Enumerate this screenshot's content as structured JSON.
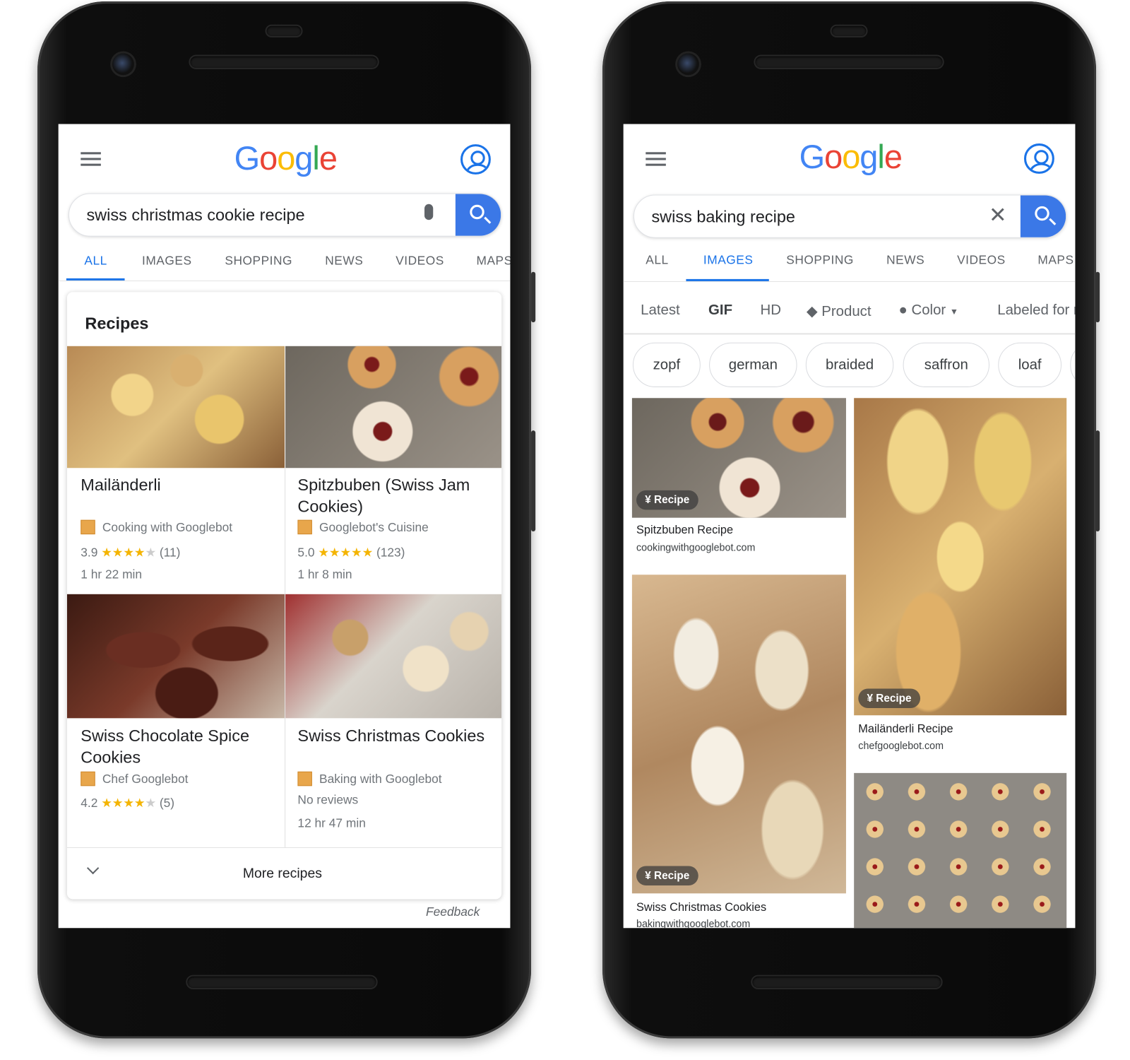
{
  "colors": {
    "accent": "#1a73e8",
    "search_button": "#3b78e7",
    "star": "#f4b400",
    "source_icon": "#e8a64b"
  },
  "logo": "Google",
  "left_phone": {
    "search_query": "swiss christmas cookie recipe",
    "tabs": [
      "ALL",
      "IMAGES",
      "SHOPPING",
      "NEWS",
      "VIDEOS",
      "MAPS"
    ],
    "active_tab": "ALL",
    "card_title": "Recipes",
    "recipes": [
      {
        "title": "Mailänderli",
        "source": "Cooking with Googlebot",
        "rating": "3.9",
        "stars": 3.9,
        "count": "(11)",
        "time": "1 hr 22 min"
      },
      {
        "title": "Spitzbuben (Swiss Jam Cookies)",
        "source": "Googlebot's Cuisine",
        "rating": "5.0",
        "stars": 5,
        "count": "(123)",
        "time": "1 hr 8 min"
      },
      {
        "title": "Swiss Chocolate Spice Cookies",
        "source": "Chef Googlebot",
        "rating": "4.2",
        "stars": 4.2,
        "count": "(5)"
      },
      {
        "title": "Swiss Christmas Cookies",
        "source": "Baking with Googlebot",
        "reviews": "No reviews",
        "time": "12 hr 47 min"
      }
    ],
    "more_label": "More recipes",
    "feedback": "Feedback"
  },
  "right_phone": {
    "search_query": "swiss baking recipe",
    "tabs": [
      "ALL",
      "IMAGES",
      "SHOPPING",
      "NEWS",
      "VIDEOS",
      "MAPS"
    ],
    "active_tab": "IMAGES",
    "filters": [
      "Latest",
      "GIF",
      "HD",
      "Product",
      "Color",
      "Labeled for reuse"
    ],
    "chips": [
      "zopf",
      "german",
      "braided",
      "saffron",
      "loaf"
    ],
    "results": [
      {
        "badge": "Recipe",
        "title": "Spitzbuben Recipe",
        "site": "cookingwithgooglebot.com"
      },
      {
        "badge": "Recipe",
        "title": "Swiss Christmas Cookies",
        "site": "bakingwithgooglebot.com"
      },
      {
        "badge": "Recipe",
        "title": "Mailänderli Recipe",
        "site": "chefgooglebot.com"
      }
    ]
  }
}
